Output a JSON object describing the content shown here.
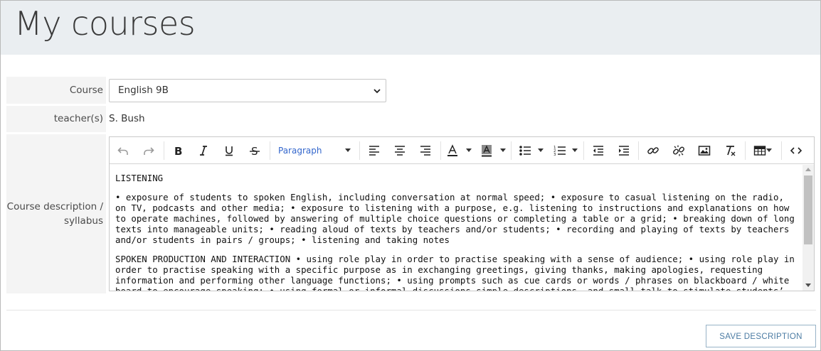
{
  "page": {
    "title": "My courses"
  },
  "form": {
    "course_label": "Course",
    "course_selected": "English 9B",
    "teacher_label": "teacher(s)",
    "teacher_value": "S. Bush",
    "description_label_line1": "Course description /",
    "description_label_line2": "syllabus"
  },
  "editor": {
    "block_format": "Paragraph",
    "toolbar_icons": [
      "undo-icon",
      "redo-icon",
      "bold-icon",
      "italic-icon",
      "underline-icon",
      "strikethrough-icon",
      "align-left-icon",
      "align-center-icon",
      "align-right-icon",
      "text-color-icon",
      "background-color-icon",
      "bullet-list-icon",
      "numbered-list-icon",
      "outdent-icon",
      "indent-icon",
      "link-icon",
      "unlink-icon",
      "image-icon",
      "clear-formatting-icon",
      "table-icon",
      "source-code-icon"
    ],
    "content": {
      "p1": "LISTENING",
      "p2": "• exposure of students to spoken English, including conversation at normal speed; • exposure to casual listening on the radio, on TV, podcasts and other media; • exposure to listening with a purpose, e.g. listening to instructions and explanations on how to operate machines, followed by answering of multiple choice questions or completing a table or a grid; • breaking down of long texts into manageable units; • reading aloud of texts by teachers and/or students; • recording and playing of texts by teachers and/or students in pairs / groups; • listening and taking notes",
      "p3": "SPOKEN PRODUCTION AND INTERACTION • using role play in order to practise speaking with a sense of audience; • using role play in order to practise speaking with a specific purpose as in exchanging greetings, giving thanks, making apologies, requesting information and performing other language functions; • using prompts such as cue cards or words / phrases on blackboard / white board to encourage speaking; • using formal or informal discussions simple descriptions, and small talk to stimulate students’ use of the language"
    }
  },
  "actions": {
    "save_label": "SAVE DESCRIPTION"
  },
  "colors": {
    "header_bg": "#eaeef1",
    "label_bg": "#f4f4f4",
    "link_blue": "#3366cc",
    "button_text": "#4b7ba3",
    "button_border": "#98b3c7"
  }
}
